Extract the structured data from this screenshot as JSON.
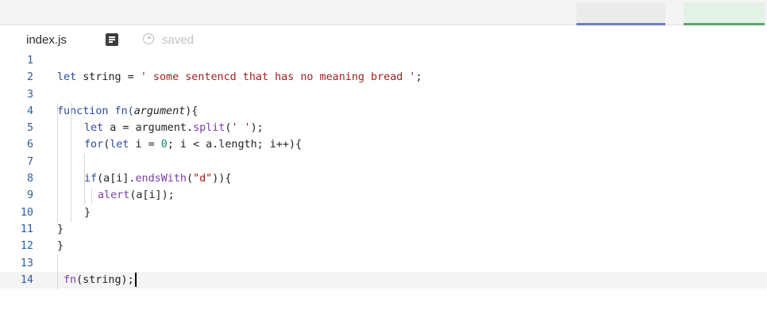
{
  "tab": {
    "filename": "index.js",
    "status": "saved"
  },
  "editor": {
    "lines": [
      {
        "n": "1"
      },
      {
        "n": "2"
      },
      {
        "n": "3"
      },
      {
        "n": "4"
      },
      {
        "n": "5"
      },
      {
        "n": "6"
      },
      {
        "n": "7"
      },
      {
        "n": "8"
      },
      {
        "n": "9"
      },
      {
        "n": "10"
      },
      {
        "n": "11"
      },
      {
        "n": "12"
      },
      {
        "n": "13"
      },
      {
        "n": "14"
      }
    ],
    "tokens": {
      "l2_kw": "let",
      "l2_plain": " string = ",
      "l2_str": "' some sentencd that has no meaning bread '",
      "l2_end": ";",
      "l4_kw": "function",
      "l4_fn": " fn(",
      "l4_param": "argument",
      "l4_end": "){",
      "l5_kw": "let",
      "l5_plain": " a = argument.",
      "l5_fn": "split",
      "l5_open": "(",
      "l5_str": "' '",
      "l5_end": ");",
      "l6_kw": "for",
      "l6_open": "(",
      "l6_kw2": "let",
      "l6_mid": " i = ",
      "l6_num": "0",
      "l6_rest": "; i < a.length; i++){",
      "l8_kw": "if",
      "l8_plain": "(a[i].",
      "l8_fn": "endsWith",
      "l8_open": "(",
      "l8_str": "\"d\"",
      "l8_end": ")){",
      "l9_fn": "alert",
      "l9_end": "(a[i]);",
      "l10": "}",
      "l11": "}",
      "l12": "}",
      "l14_fn": "fn",
      "l14_end": "(string);"
    }
  }
}
